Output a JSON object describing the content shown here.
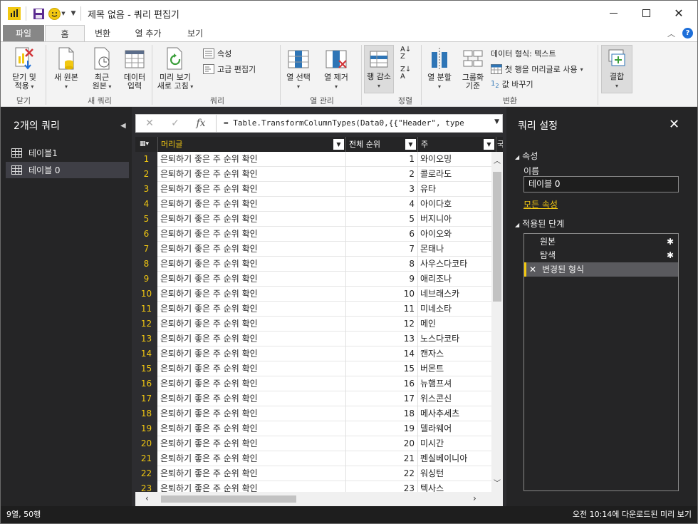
{
  "window": {
    "title": "제목 없음 - 쿼리 편집기"
  },
  "tabs": [
    {
      "label": "파일"
    },
    {
      "label": "홈"
    },
    {
      "label": "변환"
    },
    {
      "label": "열 추가"
    },
    {
      "label": "보기"
    }
  ],
  "ribbon": {
    "close_apply": "닫기 및\n적용",
    "new_source": "새 원본",
    "recent_sources": "최근\n원본",
    "enter_data": "데이터\n입력",
    "refresh_preview": "미리 보기\n새로 고침",
    "properties": "속성",
    "advanced_editor": "고급 편집기",
    "choose_columns": "열 선택",
    "remove_columns": "열 제거",
    "reduce_rows": "행 감소",
    "split_column": "열 분할",
    "group_by": "그룹화\n기준",
    "data_type": "데이터 형식: 텍스트",
    "use_first_row": "첫 행을 머리글로 사용",
    "replace_values": "값 바꾸기",
    "combine": "결합",
    "groups": {
      "close": "닫기",
      "new_query": "새 쿼리",
      "query": "쿼리",
      "manage_columns": "열 관리",
      "sort": "정렬",
      "transform": "변환"
    }
  },
  "left_pane": {
    "title": "2개의 쿼리",
    "queries": [
      {
        "label": "테이블1"
      },
      {
        "label": "테이블 0"
      }
    ]
  },
  "formula_bar": {
    "fx": "fx",
    "formula": "= Table.TransformColumnTypes(Data0,{{\"Header\", type"
  },
  "grid": {
    "columns": [
      "머리글",
      "전체 순위",
      "주",
      "국"
    ],
    "rows": [
      {
        "n": "1",
        "header": "은퇴하기 좋은 주 순위 확인",
        "rank": "1",
        "state": "와이오밍"
      },
      {
        "n": "2",
        "header": "은퇴하기 좋은 주 순위 확인",
        "rank": "2",
        "state": "콜로라도"
      },
      {
        "n": "3",
        "header": "은퇴하기 좋은 주 순위 확인",
        "rank": "3",
        "state": "유타"
      },
      {
        "n": "4",
        "header": "은퇴하기 좋은 주 순위 확인",
        "rank": "4",
        "state": "아이다호"
      },
      {
        "n": "5",
        "header": "은퇴하기 좋은 주 순위 확인",
        "rank": "5",
        "state": "버지니아"
      },
      {
        "n": "6",
        "header": "은퇴하기 좋은 주 순위 확인",
        "rank": "6",
        "state": "아이오와"
      },
      {
        "n": "7",
        "header": "은퇴하기 좋은 주 순위 확인",
        "rank": "7",
        "state": "몬태나"
      },
      {
        "n": "8",
        "header": "은퇴하기 좋은 주 순위 확인",
        "rank": "8",
        "state": "사우스다코타"
      },
      {
        "n": "9",
        "header": "은퇴하기 좋은 주 순위 확인",
        "rank": "9",
        "state": "애리조나"
      },
      {
        "n": "10",
        "header": "은퇴하기 좋은 주 순위 확인",
        "rank": "10",
        "state": "네브래스카"
      },
      {
        "n": "11",
        "header": "은퇴하기 좋은 주 순위 확인",
        "rank": "11",
        "state": "미네소타"
      },
      {
        "n": "12",
        "header": "은퇴하기 좋은 주 순위 확인",
        "rank": "12",
        "state": "메인"
      },
      {
        "n": "13",
        "header": "은퇴하기 좋은 주 순위 확인",
        "rank": "13",
        "state": "노스다코타"
      },
      {
        "n": "14",
        "header": "은퇴하기 좋은 주 순위 확인",
        "rank": "14",
        "state": "캔자스"
      },
      {
        "n": "15",
        "header": "은퇴하기 좋은 주 순위 확인",
        "rank": "15",
        "state": "버몬트"
      },
      {
        "n": "16",
        "header": "은퇴하기 좋은 주 순위 확인",
        "rank": "16",
        "state": "뉴햄프셔"
      },
      {
        "n": "17",
        "header": "은퇴하기 좋은 주 순위 확인",
        "rank": "17",
        "state": "위스콘신"
      },
      {
        "n": "18",
        "header": "은퇴하기 좋은 주 순위 확인",
        "rank": "18",
        "state": "메사추세츠"
      },
      {
        "n": "19",
        "header": "은퇴하기 좋은 주 순위 확인",
        "rank": "19",
        "state": "델라웨어"
      },
      {
        "n": "20",
        "header": "은퇴하기 좋은 주 순위 확인",
        "rank": "20",
        "state": "미시간"
      },
      {
        "n": "21",
        "header": "은퇴하기 좋은 주 순위 확인",
        "rank": "21",
        "state": "펜실베이니아"
      },
      {
        "n": "22",
        "header": "은퇴하기 좋은 주 순위 확인",
        "rank": "22",
        "state": "워싱턴"
      },
      {
        "n": "23",
        "header": "은퇴하기 좋은 주 순위 확인",
        "rank": "23",
        "state": "텍사스"
      }
    ]
  },
  "right_pane": {
    "title": "쿼리 설정",
    "properties_section": "속성",
    "name_label": "이름",
    "name_value": "테이블 0",
    "all_properties": "모든 속성",
    "applied_steps_section": "적용된 단계",
    "steps": [
      {
        "label": "원본"
      },
      {
        "label": "탐색"
      },
      {
        "label": "변경된 형식"
      }
    ]
  },
  "status": {
    "left": "9열, 50행",
    "right": "오전 10:14에 다운로드된 미리 보기"
  },
  "colors": {
    "accent": "#f2c811",
    "dark_pane": "#252526",
    "ribbon": "#f3f3f3"
  }
}
